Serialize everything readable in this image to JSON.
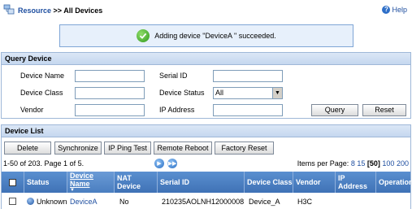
{
  "header": {
    "breadcrumb_root": "Resource",
    "breadcrumb_sep": " >> ",
    "breadcrumb_current": "All Devices",
    "help_label": "Help"
  },
  "message": {
    "text": "Adding device \"DeviceA \" succeeded."
  },
  "query": {
    "title": "Query Device",
    "device_name_label": "Device Name",
    "device_name_value": "",
    "device_class_label": "Device Class",
    "device_class_value": "",
    "vendor_label": "Vendor",
    "vendor_value": "",
    "serial_id_label": "Serial ID",
    "serial_id_value": "",
    "device_status_label": "Device Status",
    "device_status_value": "All",
    "ip_address_label": "IP Address",
    "ip_address_value": "",
    "query_button": "Query",
    "reset_button": "Reset"
  },
  "list": {
    "title": "Device List",
    "buttons": {
      "delete": "Delete",
      "synchronize": "Synchronize",
      "ping": "IP Ping Test",
      "reboot": "Remote Reboot",
      "factory_reset": "Factory Reset"
    },
    "pager_text": "1-50 of 203. Page 1 of 5.",
    "items_per_page_label": "Items per Page:",
    "per_page_options": [
      "8",
      "15",
      "[50]",
      "100",
      "200"
    ],
    "columns": {
      "status": "Status",
      "device_name": "Device Name",
      "nat_device": "NAT Device",
      "serial_id": "Serial ID",
      "device_class": "Device Class",
      "vendor": "Vendor",
      "ip_address": "IP Address",
      "operation": "Operation"
    },
    "rows": [
      {
        "status": "Unknown",
        "device_name": "DeviceA",
        "nat_device": "No",
        "serial_id": "210235AOLNH12000008",
        "device_class": "Device_A",
        "vendor": "H3C",
        "ip_address": "",
        "operation": ""
      }
    ]
  },
  "colors": {
    "link": "#1f4fa0",
    "table_header": "#3f72b6",
    "message_bg": "#e7f0fb"
  }
}
